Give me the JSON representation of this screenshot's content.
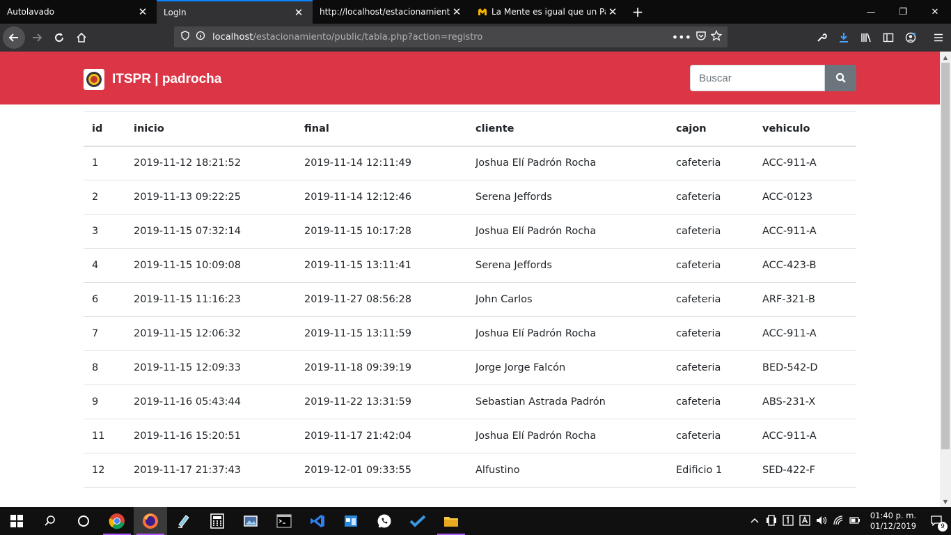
{
  "browser": {
    "tabs": [
      {
        "label": "Autolavado",
        "active": false
      },
      {
        "label": "LogIn",
        "active": true
      },
      {
        "label": "http://localhost/estacionamiento/p",
        "active": false
      },
      {
        "label": "La Mente es igual que un Parac",
        "active": false
      }
    ],
    "url_host": "localhost",
    "url_path": "/estacionamiento/public/tabla.php?action=registro"
  },
  "site": {
    "brand": "ITSPR | padrocha",
    "accent": "#dc3545",
    "search_placeholder": "Buscar"
  },
  "table": {
    "headers": [
      "id",
      "inicio",
      "final",
      "cliente",
      "cajon",
      "vehiculo"
    ],
    "rows": [
      [
        "1",
        "2019-11-12 18:21:52",
        "2019-11-14 12:11:49",
        "Joshua Elí Padrón Rocha",
        "cafeteria",
        "ACC-911-A"
      ],
      [
        "2",
        "2019-11-13 09:22:25",
        "2019-11-14 12:12:46",
        "Serena Jeffords",
        "cafeteria",
        "ACC-0123"
      ],
      [
        "3",
        "2019-11-15 07:32:14",
        "2019-11-15 10:17:28",
        "Joshua Elí Padrón Rocha",
        "cafeteria",
        "ACC-911-A"
      ],
      [
        "4",
        "2019-11-15 10:09:08",
        "2019-11-15 13:11:41",
        "Serena Jeffords",
        "cafeteria",
        "ACC-423-B"
      ],
      [
        "6",
        "2019-11-15 11:16:23",
        "2019-11-27 08:56:28",
        "John Carlos",
        "cafeteria",
        "ARF-321-B"
      ],
      [
        "7",
        "2019-11-15 12:06:32",
        "2019-11-15 13:11:59",
        "Joshua Elí Padrón Rocha",
        "cafeteria",
        "ACC-911-A"
      ],
      [
        "8",
        "2019-11-15 12:09:33",
        "2019-11-18 09:39:19",
        "Jorge Jorge Falcón",
        "cafeteria",
        "BED-542-D"
      ],
      [
        "9",
        "2019-11-16 05:43:44",
        "2019-11-22 13:31:59",
        "Sebastian Astrada Padrón",
        "cafeteria",
        "ABS-231-X"
      ],
      [
        "11",
        "2019-11-16 15:20:51",
        "2019-11-17 21:42:04",
        "Joshua Elí Padrón Rocha",
        "cafeteria",
        "ACC-911-A"
      ],
      [
        "12",
        "2019-11-17 21:37:43",
        "2019-12-01 09:33:55",
        "Alfustino",
        "Edificio 1",
        "SED-422-F"
      ]
    ]
  },
  "taskbar": {
    "time": "01:40 p. m.",
    "date": "01/12/2019",
    "notifications": "9"
  }
}
